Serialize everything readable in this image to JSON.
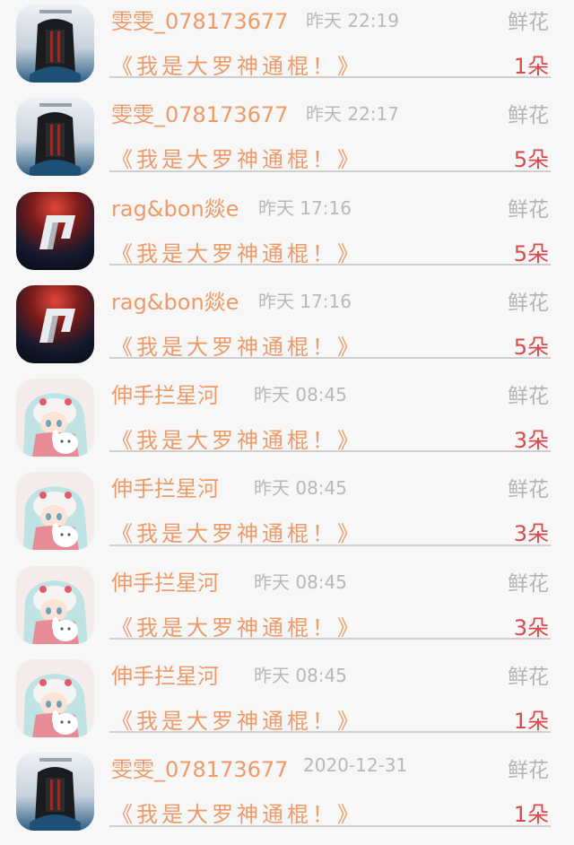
{
  "rows": [
    {
      "user": "雯雯_078173677",
      "time": "昨天  22:19",
      "type": "鲜花",
      "gift": "《我是大罗神通棍！》",
      "count": "1朵",
      "avatar": "backpack-avatar"
    },
    {
      "user": "雯雯_078173677",
      "time": "昨天  22:17",
      "type": "鲜花",
      "gift": "《我是大罗神通棍！》",
      "count": "5朵",
      "avatar": "backpack-avatar"
    },
    {
      "user": "rag&bon燚e",
      "time": "昨天  17:16",
      "type": "鲜花",
      "gift": "《我是大罗神通棍！》",
      "count": "5朵",
      "avatar": "nfs-avatar"
    },
    {
      "user": "rag&bon燚e",
      "time": "昨天  17:16",
      "type": "鲜花",
      "gift": "《我是大罗神通棍！》",
      "count": "5朵",
      "avatar": "nfs-avatar"
    },
    {
      "user": "伸手拦星河",
      "time": "昨天  08:45",
      "type": "鲜花",
      "gift": "《我是大罗神通棍！》",
      "count": "3朵",
      "avatar": "anime-avatar"
    },
    {
      "user": "伸手拦星河",
      "time": "昨天  08:45",
      "type": "鲜花",
      "gift": "《我是大罗神通棍！》",
      "count": "3朵",
      "avatar": "anime-avatar"
    },
    {
      "user": "伸手拦星河",
      "time": "昨天  08:45",
      "type": "鲜花",
      "gift": "《我是大罗神通棍！》",
      "count": "3朵",
      "avatar": "anime-avatar"
    },
    {
      "user": "伸手拦星河",
      "time": "昨天  08:45",
      "type": "鲜花",
      "gift": "《我是大罗神通棍！》",
      "count": "1朵",
      "avatar": "anime-avatar"
    },
    {
      "user": "雯雯_078173677",
      "time": "2020-12-31",
      "type": "鲜花",
      "gift": "《我是大罗神通棍！》",
      "count": "1朵",
      "avatar": "backpack-avatar"
    }
  ]
}
